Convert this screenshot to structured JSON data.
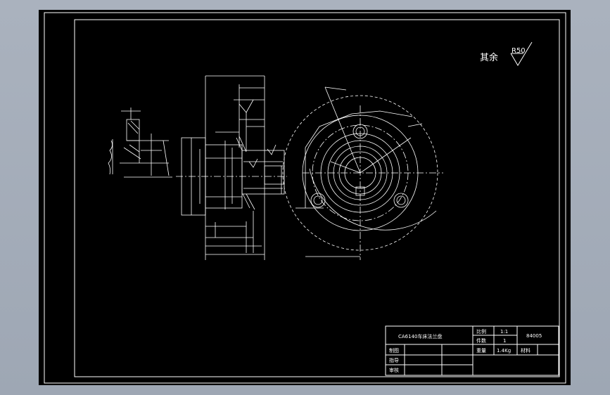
{
  "drawing": {
    "roughness_note": {
      "prefix": "其余",
      "value": "R50"
    },
    "title_block": {
      "part_name": "CA6140车床法兰盘",
      "scale_label": "比例",
      "scale_value": "1:1",
      "quantity_label": "件数",
      "quantity_value": "1",
      "drawing_number": "84005",
      "drawn_label": "制图",
      "weight_label": "重量",
      "weight_value": "1.4Kg",
      "material_label": "材料",
      "guide_label": "指导",
      "review_label": "审核"
    }
  },
  "colors": {
    "background": "#000000",
    "outline": "#ffffff",
    "viewport": "#a4acb8"
  }
}
